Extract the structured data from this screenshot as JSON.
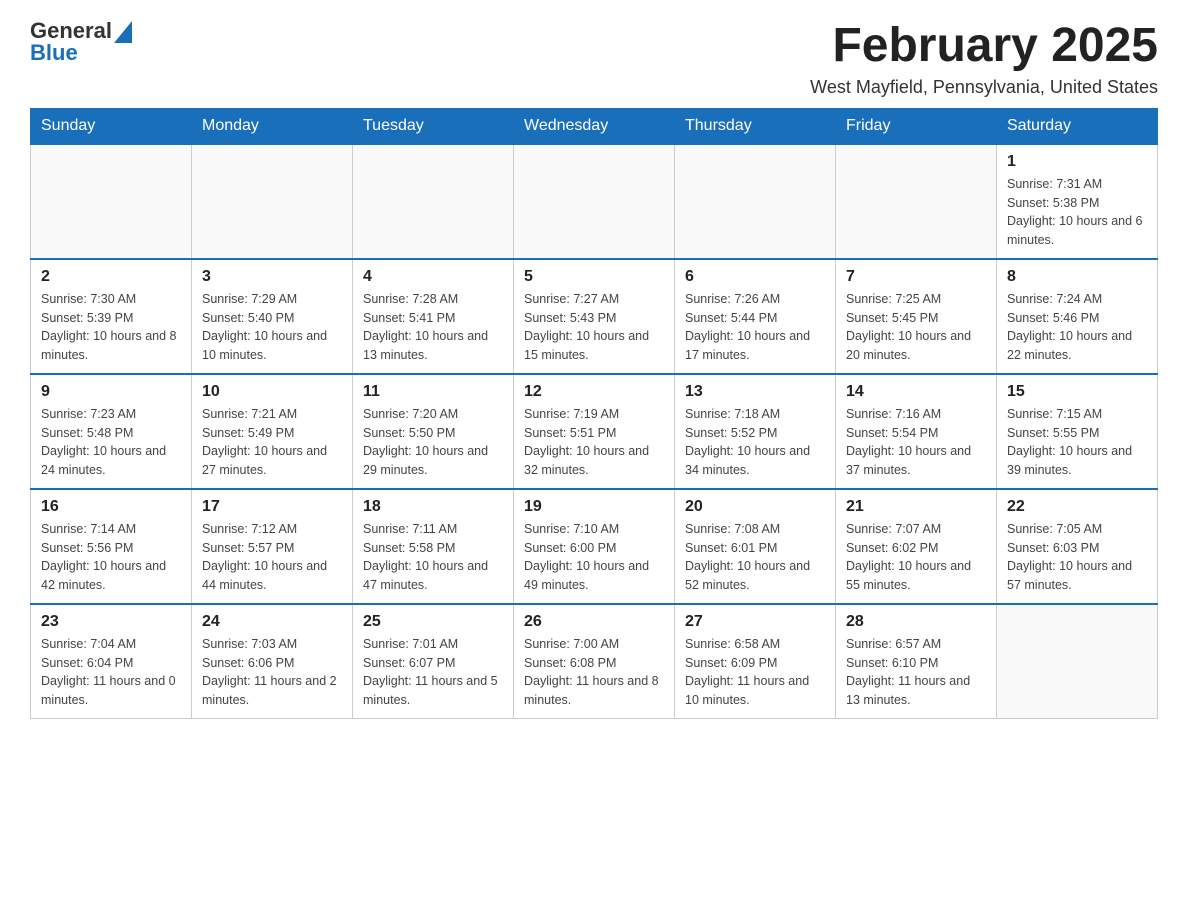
{
  "logo": {
    "text_general": "General",
    "text_blue": "Blue"
  },
  "title": "February 2025",
  "subtitle": "West Mayfield, Pennsylvania, United States",
  "days_of_week": [
    "Sunday",
    "Monday",
    "Tuesday",
    "Wednesday",
    "Thursday",
    "Friday",
    "Saturday"
  ],
  "weeks": [
    [
      {
        "day": "",
        "info": ""
      },
      {
        "day": "",
        "info": ""
      },
      {
        "day": "",
        "info": ""
      },
      {
        "day": "",
        "info": ""
      },
      {
        "day": "",
        "info": ""
      },
      {
        "day": "",
        "info": ""
      },
      {
        "day": "1",
        "info": "Sunrise: 7:31 AM\nSunset: 5:38 PM\nDaylight: 10 hours and 6 minutes."
      }
    ],
    [
      {
        "day": "2",
        "info": "Sunrise: 7:30 AM\nSunset: 5:39 PM\nDaylight: 10 hours and 8 minutes."
      },
      {
        "day": "3",
        "info": "Sunrise: 7:29 AM\nSunset: 5:40 PM\nDaylight: 10 hours and 10 minutes."
      },
      {
        "day": "4",
        "info": "Sunrise: 7:28 AM\nSunset: 5:41 PM\nDaylight: 10 hours and 13 minutes."
      },
      {
        "day": "5",
        "info": "Sunrise: 7:27 AM\nSunset: 5:43 PM\nDaylight: 10 hours and 15 minutes."
      },
      {
        "day": "6",
        "info": "Sunrise: 7:26 AM\nSunset: 5:44 PM\nDaylight: 10 hours and 17 minutes."
      },
      {
        "day": "7",
        "info": "Sunrise: 7:25 AM\nSunset: 5:45 PM\nDaylight: 10 hours and 20 minutes."
      },
      {
        "day": "8",
        "info": "Sunrise: 7:24 AM\nSunset: 5:46 PM\nDaylight: 10 hours and 22 minutes."
      }
    ],
    [
      {
        "day": "9",
        "info": "Sunrise: 7:23 AM\nSunset: 5:48 PM\nDaylight: 10 hours and 24 minutes."
      },
      {
        "day": "10",
        "info": "Sunrise: 7:21 AM\nSunset: 5:49 PM\nDaylight: 10 hours and 27 minutes."
      },
      {
        "day": "11",
        "info": "Sunrise: 7:20 AM\nSunset: 5:50 PM\nDaylight: 10 hours and 29 minutes."
      },
      {
        "day": "12",
        "info": "Sunrise: 7:19 AM\nSunset: 5:51 PM\nDaylight: 10 hours and 32 minutes."
      },
      {
        "day": "13",
        "info": "Sunrise: 7:18 AM\nSunset: 5:52 PM\nDaylight: 10 hours and 34 minutes."
      },
      {
        "day": "14",
        "info": "Sunrise: 7:16 AM\nSunset: 5:54 PM\nDaylight: 10 hours and 37 minutes."
      },
      {
        "day": "15",
        "info": "Sunrise: 7:15 AM\nSunset: 5:55 PM\nDaylight: 10 hours and 39 minutes."
      }
    ],
    [
      {
        "day": "16",
        "info": "Sunrise: 7:14 AM\nSunset: 5:56 PM\nDaylight: 10 hours and 42 minutes."
      },
      {
        "day": "17",
        "info": "Sunrise: 7:12 AM\nSunset: 5:57 PM\nDaylight: 10 hours and 44 minutes."
      },
      {
        "day": "18",
        "info": "Sunrise: 7:11 AM\nSunset: 5:58 PM\nDaylight: 10 hours and 47 minutes."
      },
      {
        "day": "19",
        "info": "Sunrise: 7:10 AM\nSunset: 6:00 PM\nDaylight: 10 hours and 49 minutes."
      },
      {
        "day": "20",
        "info": "Sunrise: 7:08 AM\nSunset: 6:01 PM\nDaylight: 10 hours and 52 minutes."
      },
      {
        "day": "21",
        "info": "Sunrise: 7:07 AM\nSunset: 6:02 PM\nDaylight: 10 hours and 55 minutes."
      },
      {
        "day": "22",
        "info": "Sunrise: 7:05 AM\nSunset: 6:03 PM\nDaylight: 10 hours and 57 minutes."
      }
    ],
    [
      {
        "day": "23",
        "info": "Sunrise: 7:04 AM\nSunset: 6:04 PM\nDaylight: 11 hours and 0 minutes."
      },
      {
        "day": "24",
        "info": "Sunrise: 7:03 AM\nSunset: 6:06 PM\nDaylight: 11 hours and 2 minutes."
      },
      {
        "day": "25",
        "info": "Sunrise: 7:01 AM\nSunset: 6:07 PM\nDaylight: 11 hours and 5 minutes."
      },
      {
        "day": "26",
        "info": "Sunrise: 7:00 AM\nSunset: 6:08 PM\nDaylight: 11 hours and 8 minutes."
      },
      {
        "day": "27",
        "info": "Sunrise: 6:58 AM\nSunset: 6:09 PM\nDaylight: 11 hours and 10 minutes."
      },
      {
        "day": "28",
        "info": "Sunrise: 6:57 AM\nSunset: 6:10 PM\nDaylight: 11 hours and 13 minutes."
      },
      {
        "day": "",
        "info": ""
      }
    ]
  ]
}
